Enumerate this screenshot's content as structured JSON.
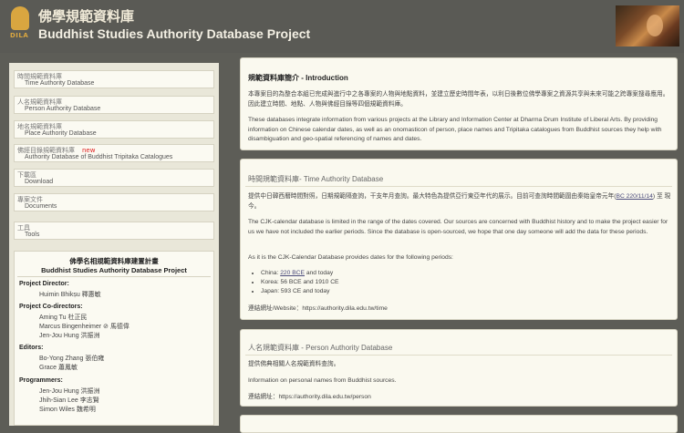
{
  "header": {
    "logo_text": "DILA",
    "title_zh": "佛學規範資料庫",
    "title_en": "Buddhist Studies Authority Database Project"
  },
  "sidebar": {
    "items": [
      {
        "zh": "時間規範資料庫",
        "en": "Time Authority Database"
      },
      {
        "zh": "人名規範資料庫",
        "en": "Person Authority Database"
      },
      {
        "zh": "地名規範資料庫",
        "en": "Place Authority Database"
      },
      {
        "zh": "佛經目錄規範資料庫",
        "new": "new",
        "en": "Authority Database of Buddhist Tripitaka Catalogues"
      },
      {
        "zh": "下載區",
        "en": "Download"
      },
      {
        "zh": "專案文件",
        "en": "Documents"
      },
      {
        "zh": "工具",
        "en": "Tools"
      }
    ],
    "credits": {
      "title_zh": "佛學名相規範資料庫建置計畫",
      "title_en": "Buddhist Studies Authority Database Project",
      "director_label": "Project Director:",
      "director": "Huimin Bhikṣu 釋惠敏",
      "codirectors_label": "Project Co-directors:",
      "codirectors": [
        "Aming Tu 杜正民",
        "Marcus Bingenheimer ⊘ 馬德偉",
        "Jen-Jou Hung 洪振洲"
      ],
      "editors_label": "Editors:",
      "editors": [
        "Bo-Yong Zhang 張伯雍",
        "Grace 蕭鳳敏"
      ],
      "programmers_label": "Programmers:",
      "programmers": [
        "Jen-Jou Hung 洪振洲",
        "Jhih-Sian Lee 李志賢",
        "Simon Wiles 魏希明"
      ]
    }
  },
  "main": {
    "intro": {
      "heading": "規範資料庫簡介 - Introduction",
      "p1": "本專案目的為整合本組已完成與進行中之各專案的人物與地點資料，並建立歷史時間年表，以利日後數位佛學專案之資源共享與未來可能之跨專案搜尋應用。因此建立時間、地點、人物與佛經目錄等四個規範資料庫。",
      "p2": "These databases integrate information from various projects at the Library and Information Center at Dharma Drum Institute of Liberal Arts. By providing information on Chinese calendar dates, as well as an onomasticon of person, place names and Tripitaka catalogues from Buddhist sources they help with disambiguation and geo-spatial referencing of names and dates."
    },
    "time": {
      "heading": "時間規範資料庫- Time Authority Database",
      "p1_pre": "提供中日韓西曆時間對照，日期規範隔查詢，干支年月查詢。最大特色為提供亞行東亞年代的展示。目前可查詢時間範圍由秦始皇帝元年(",
      "p1_link": "BC 220/11/14",
      "p1_post": ") 至 現今。",
      "p2": "The CJK-calendar database is limited in the range of the dates covered. Our sources are concerned with Buddhist history and to make the project easier for us we have not included the earlier periods. Since the database is open-sourced, we hope that one day someone will add the data for these periods.",
      "p3": "As it is the CJK-Calendar Database provides dates for the following periods:",
      "periods": [
        {
          "pre": "China: ",
          "link": "220 BCE",
          "post": " and today"
        },
        {
          "pre": "Korea: 56 BCE and 1910 CE",
          "link": "",
          "post": ""
        },
        {
          "pre": "Japan: 593 CE and today",
          "link": "",
          "post": ""
        }
      ],
      "site_label": "連結網址/Website：",
      "site": "https://authority.dila.edu.tw/time"
    },
    "person": {
      "heading": "人名規範資料庫 - Person Authority Database",
      "p1": "提供佛典相關人名規範資料查詢。",
      "p2": "Information on personal names from Buddhist sources.",
      "site_label": "連結網址：",
      "site": "https://authority.dila.edu.tw/person"
    }
  }
}
